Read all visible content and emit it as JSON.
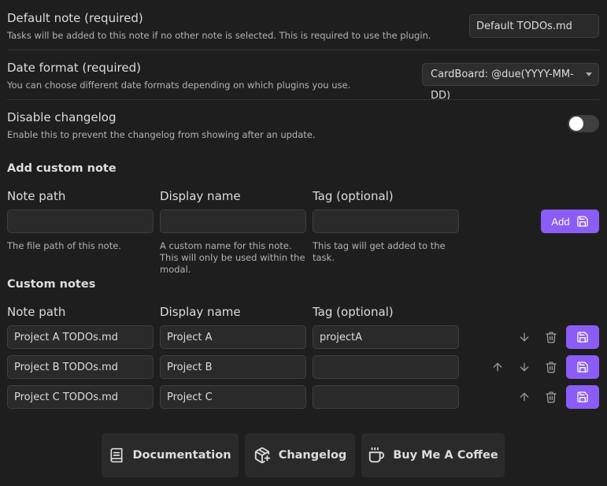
{
  "default_note": {
    "name": "Default note (required)",
    "desc": "Tasks will be added to this note if no other note is selected. This is required to use the plugin.",
    "value": "Default TODOs.md"
  },
  "date_format": {
    "name": "Date format (required)",
    "desc": "You can choose different date formats depending on which plugins you use.",
    "selected": "CardBoard: @due(YYYY-MM-DD)"
  },
  "changelog_setting": {
    "name": "Disable changelog",
    "desc": "Enable this to prevent the changelog from showing after an update.",
    "enabled": false
  },
  "add_custom_note": {
    "heading": "Add custom note",
    "col_note_path": "Note path",
    "col_display_name": "Display name",
    "col_tag": "Tag (optional)",
    "note_path_value": "",
    "display_name_value": "",
    "tag_value": "",
    "hint_note_path": "The file path of this note.",
    "hint_display_name": "A custom name for this note. This will only be used within the modal.",
    "hint_tag": "This tag will get added to the task.",
    "add_label": "Add"
  },
  "custom_notes": {
    "heading": "Custom notes",
    "col_note_path": "Note path",
    "col_display_name": "Display name",
    "col_tag": "Tag (optional)",
    "rows": [
      {
        "path": "Project A TODOs.md",
        "name": "Project A",
        "tag": "projectA"
      },
      {
        "path": "Project B TODOs.md",
        "name": "Project B",
        "tag": ""
      },
      {
        "path": "Project C TODOs.md",
        "name": "Project C",
        "tag": ""
      }
    ]
  },
  "footer": {
    "documentation": "Documentation",
    "changelog": "Changelog",
    "coffee": "Buy Me A Coffee"
  },
  "colors": {
    "accent": "#8b5cf6",
    "background": "#1e1e1e",
    "input_bg": "#2a2a2a"
  }
}
